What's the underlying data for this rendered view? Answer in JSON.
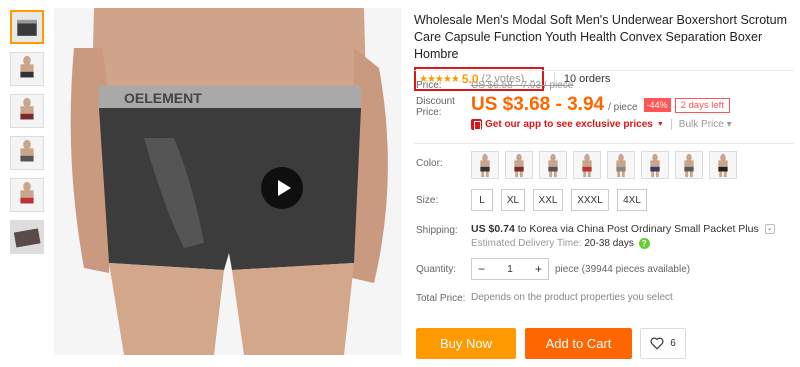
{
  "product": {
    "title": "Wholesale Men's Modal Soft Men's Underwear Boxershort Scrotum Care Capsule Function Youth Health Convex Separation Boxer Hombre",
    "rating": {
      "stars": "★★★★★",
      "score": "5.0",
      "votes": "(2 votes)",
      "chevron": "⌄"
    },
    "orders": "10 orders",
    "image_brand_text": "OELEMENT"
  },
  "price": {
    "label": "Price:",
    "original": "US $6.58 - 7.03 / piece",
    "discount_label": "Discount Price:",
    "discount_value": "US $3.68 - 3.94",
    "unit": "/ piece",
    "discount_badge": "-44%",
    "days_left": "2 days left",
    "app_promo": "Get our app to see exclusive prices",
    "bulk_price": "Bulk Price ▾"
  },
  "color": {
    "label": "Color:",
    "options_count": 8
  },
  "size": {
    "label": "Size:",
    "options": [
      "L",
      "XL",
      "XXL",
      "XXXL",
      "4XL"
    ]
  },
  "shipping": {
    "label": "Shipping:",
    "cost": "US $0.74",
    "text": "to Korea via China Post Ordinary Small Packet Plus",
    "eta_label": "Estimated Delivery Time:",
    "eta_days": "20-38 days"
  },
  "quantity": {
    "label": "Quantity:",
    "value": "1",
    "minus": "−",
    "plus": "+",
    "available": "piece (39944 pieces available)"
  },
  "total": {
    "label": "Total Price:",
    "value": "Depends on the product properties you select"
  },
  "actions": {
    "buy_now": "Buy Now",
    "add_to_cart": "Add to Cart",
    "wishlist_count": "6"
  },
  "colors_theme": {
    "accent_orange": "#ff9900",
    "price_orange": "#ff6600",
    "alert_red": "#d9161a"
  }
}
